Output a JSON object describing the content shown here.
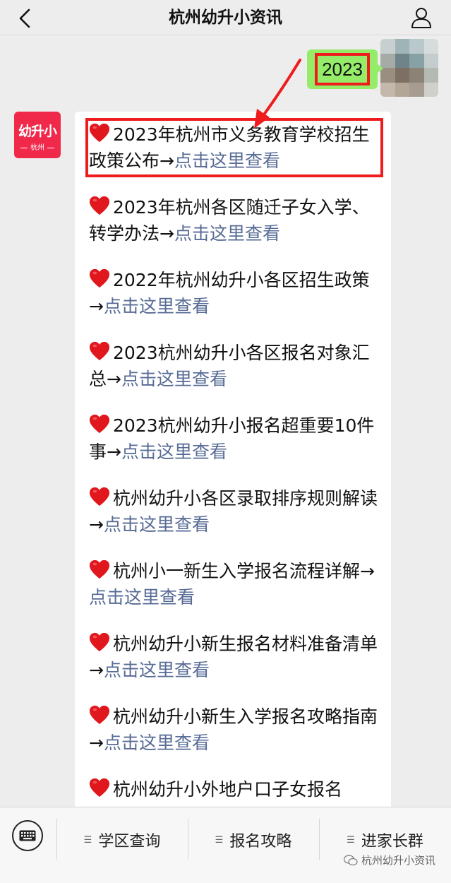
{
  "header": {
    "title": "杭州幼升小资讯"
  },
  "chat": {
    "sent_message": "2023",
    "bot_avatar": {
      "main": "幼升小",
      "sub": "杭州"
    },
    "items": [
      {
        "text": "2023年杭州市义务教育学校招生政策公布",
        "arrow": "→",
        "link": "点击这里查看"
      },
      {
        "text": "2023年杭州各区随迁子女入学、转学办法",
        "arrow": "→",
        "link": "点击这里查看"
      },
      {
        "text": "2022年杭州幼升小各区招生政策",
        "arrow": "→",
        "link": "点击这里查看"
      },
      {
        "text": "2023杭州幼升小各区报名对象汇总",
        "arrow": "→",
        "link": "点击这里查看"
      },
      {
        "text": "2023杭州幼升小报名超重要10件事",
        "arrow": "→",
        "link": "点击这里查看"
      },
      {
        "text": "杭州幼升小各区录取排序规则解读",
        "arrow": "→",
        "link": "点击这里查看"
      },
      {
        "text": "杭州小一新生入学报名流程详解",
        "arrow": "→",
        "link": "点击这里查看"
      },
      {
        "text": "杭州幼升小新生报名材料准备清单",
        "arrow": "→",
        "link": "点击这里查看"
      },
      {
        "text": "杭州幼升小新生入学报名攻略指南",
        "arrow": "→",
        "link": "点击这里查看"
      },
      {
        "text": "杭州幼升小外地户口子女报名",
        "arrow": "",
        "link": ""
      }
    ]
  },
  "bottom_menu": {
    "items": [
      "学区查询",
      "报名攻略",
      "进家长群"
    ],
    "watermark": "杭州幼升小资讯"
  },
  "colors": {
    "link": "#576b95",
    "sent_bubble": "#95ec69",
    "highlight": "#ee1c1c",
    "brand": "#f0294b"
  },
  "icons": [
    "back-icon",
    "user-profile-icon",
    "heart-icon",
    "keyboard-icon",
    "menu-list-icon",
    "wechat-icon"
  ]
}
